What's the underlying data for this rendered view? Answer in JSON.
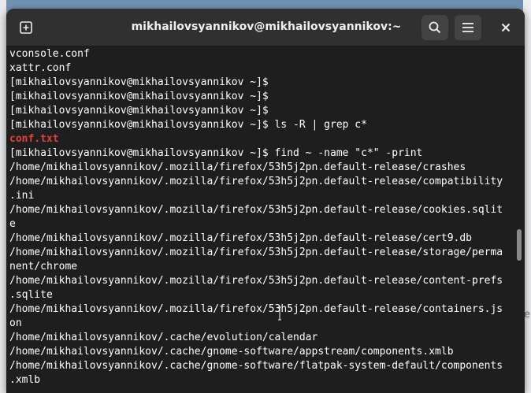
{
  "window": {
    "title": "mikhailovsyannikov@mikhailovsyannikov:~"
  },
  "headerbar": {
    "new_tab_icon": "new-tab-icon",
    "search_icon": "search-icon",
    "menu_icon": "hamburger-menu-icon",
    "close_icon": "close-icon"
  },
  "background": {
    "fragment_right": "er",
    "fragment_left": "a"
  },
  "terminal": {
    "lines": [
      {
        "text": "vconsole.conf",
        "style": "normal"
      },
      {
        "text": "xattr.conf",
        "style": "normal"
      },
      {
        "text": "[mikhailovsyannikov@mikhailovsyannikov ~]$",
        "style": "normal"
      },
      {
        "text": "[mikhailovsyannikov@mikhailovsyannikov ~]$",
        "style": "normal"
      },
      {
        "text": "[mikhailovsyannikov@mikhailovsyannikov ~]$",
        "style": "normal"
      },
      {
        "text": "[mikhailovsyannikov@mikhailovsyannikov ~]$ ls -R | grep c*",
        "style": "normal"
      },
      {
        "text": "conf.txt",
        "style": "red"
      },
      {
        "text": "[mikhailovsyannikov@mikhailovsyannikov ~]$ find ~ -name \"c*\" -print",
        "style": "normal"
      },
      {
        "text": "/home/mikhailovsyannikov/.mozilla/firefox/53h5j2pn.default-release/crashes",
        "style": "normal"
      },
      {
        "text": "/home/mikhailovsyannikov/.mozilla/firefox/53h5j2pn.default-release/compatibility",
        "style": "normal"
      },
      {
        "text": ".ini",
        "style": "normal"
      },
      {
        "text": "/home/mikhailovsyannikov/.mozilla/firefox/53h5j2pn.default-release/cookies.sqlit",
        "style": "normal"
      },
      {
        "text": "e",
        "style": "normal"
      },
      {
        "text": "/home/mikhailovsyannikov/.mozilla/firefox/53h5j2pn.default-release/cert9.db",
        "style": "normal"
      },
      {
        "text": "/home/mikhailovsyannikov/.mozilla/firefox/53h5j2pn.default-release/storage/perma",
        "style": "normal"
      },
      {
        "text": "nent/chrome",
        "style": "normal"
      },
      {
        "text": "/home/mikhailovsyannikov/.mozilla/firefox/53h5j2pn.default-release/content-prefs",
        "style": "normal"
      },
      {
        "text": ".sqlite",
        "style": "normal"
      },
      {
        "text": "/home/mikhailovsyannikov/.mozilla/firefox/53h5j2pn.default-release/containers.js",
        "style": "normal"
      },
      {
        "text": "on",
        "style": "normal"
      },
      {
        "text": "/home/mikhailovsyannikov/.cache/evolution/calendar",
        "style": "normal"
      },
      {
        "text": "/home/mikhailovsyannikov/.cache/gnome-software/appstream/components.xmlb",
        "style": "normal"
      },
      {
        "text": "/home/mikhailovsyannikov/.cache/gnome-software/flatpak-system-default/components",
        "style": "normal"
      },
      {
        "text": ".xmlb",
        "style": "normal"
      }
    ]
  },
  "colors": {
    "terminal_bg": "#1e1e1e",
    "headerbar_bg": "#303030",
    "text": "#ffffff",
    "highlight_red": "#e0413e"
  },
  "scrollbar": {
    "position_fraction": 0.58
  }
}
